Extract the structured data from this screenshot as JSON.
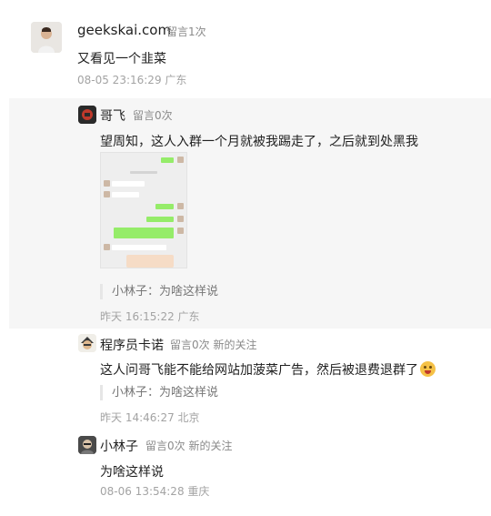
{
  "comment": {
    "author": "geekskai.com",
    "meta": "留言1次",
    "text": "又看见一个韭菜",
    "time": "08-05 23:16:29 广东"
  },
  "replies": [
    {
      "author": "哥飞",
      "meta": "留言0次",
      "text": "望周知，这人入群一个月就被我踢走了，之后就到处黑我",
      "quote": "小林子：为啥这样说",
      "time": "昨天 16:15:22 广东"
    },
    {
      "author": "程序员卡诺",
      "meta": "留言0次 新的关注",
      "text": "这人问哥飞能不能给网站加菠菜广告，然后被退费退群了",
      "quote": "小林子：为啥这样说",
      "time": "昨天 14:46:27 北京"
    },
    {
      "author": "小林子",
      "meta": "留言0次 新的关注",
      "text": "为啥这样说",
      "time": "08-06 13:54:28 重庆"
    }
  ]
}
